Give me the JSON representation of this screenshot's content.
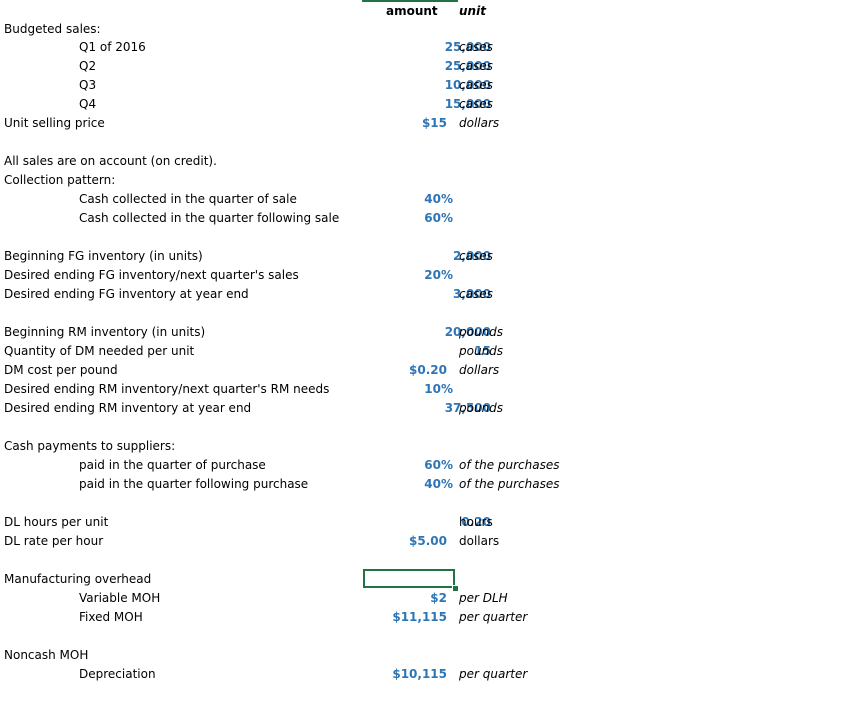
{
  "header": {
    "amount": "amount",
    "unit": "unit"
  },
  "rows": {
    "budgeted_sales": "Budgeted sales:",
    "q1": {
      "label": "Q1 of 2016",
      "value": "25,000",
      "unit": "cases"
    },
    "q2": {
      "label": "Q2",
      "value": "25,000",
      "unit": "cases"
    },
    "q3": {
      "label": "Q3",
      "value": "10,000",
      "unit": "cases"
    },
    "q4": {
      "label": "Q4",
      "value": "15,000",
      "unit": "cases"
    },
    "price": {
      "label": "Unit selling price",
      "value": "$15",
      "unit": "dollars"
    },
    "credit": "All sales are on account (on credit).",
    "collection": "Collection pattern:",
    "coll_q": {
      "label": "Cash collected in the quarter of sale",
      "value": "40%"
    },
    "coll_next": {
      "label": "Cash collected in the quarter following sale",
      "value": "60%"
    },
    "beg_fg": {
      "label": "Beginning FG inventory (in units)",
      "value": "2,000",
      "unit": "cases"
    },
    "end_fg_pct": {
      "label": "Desired ending FG inventory/next quarter's sales",
      "value": "20%"
    },
    "end_fg_year": {
      "label": "Desired ending FG inventory at year end",
      "value": "3,000",
      "unit": "cases"
    },
    "beg_rm": {
      "label": "Beginning RM inventory (in units)",
      "value": "20,000",
      "unit": "pounds"
    },
    "dm_qty": {
      "label": "Quantity of DM needed per unit",
      "value": "15",
      "unit": "pounds"
    },
    "dm_cost": {
      "label": "DM cost per pound",
      "value": "$0.20",
      "unit": "dollars"
    },
    "end_rm_pct": {
      "label": "Desired ending RM inventory/next quarter's RM needs",
      "value": "10%"
    },
    "end_rm_year": {
      "label": "Desired ending RM inventory at year end",
      "value": "37,500",
      "unit": "pounds"
    },
    "cash_pay": "Cash payments to suppliers:",
    "pay_q": {
      "label": "paid in the quarter of purchase",
      "value": "60%",
      "unit": "of the purchases"
    },
    "pay_next": {
      "label": "paid in the quarter following purchase",
      "value": "40%",
      "unit": "of the purchases"
    },
    "dl_hours": {
      "label": "DL hours per unit",
      "value": "0.20",
      "unit": "hours"
    },
    "dl_rate": {
      "label": "DL rate per hour",
      "value": "$5.00",
      "unit": "dollars"
    },
    "moh": "Manufacturing overhead",
    "var_moh": {
      "label": "Variable MOH",
      "value": "$2",
      "unit": "per DLH"
    },
    "fixed_moh": {
      "label": "Fixed MOH",
      "value": "$11,115",
      "unit": "per quarter"
    },
    "noncash": "Noncash MOH",
    "depr": {
      "label": "Depreciation",
      "value": "$10,115",
      "unit": "per quarter"
    }
  },
  "colors": {
    "value_text": "#2e75b6",
    "selection": "#217346"
  }
}
